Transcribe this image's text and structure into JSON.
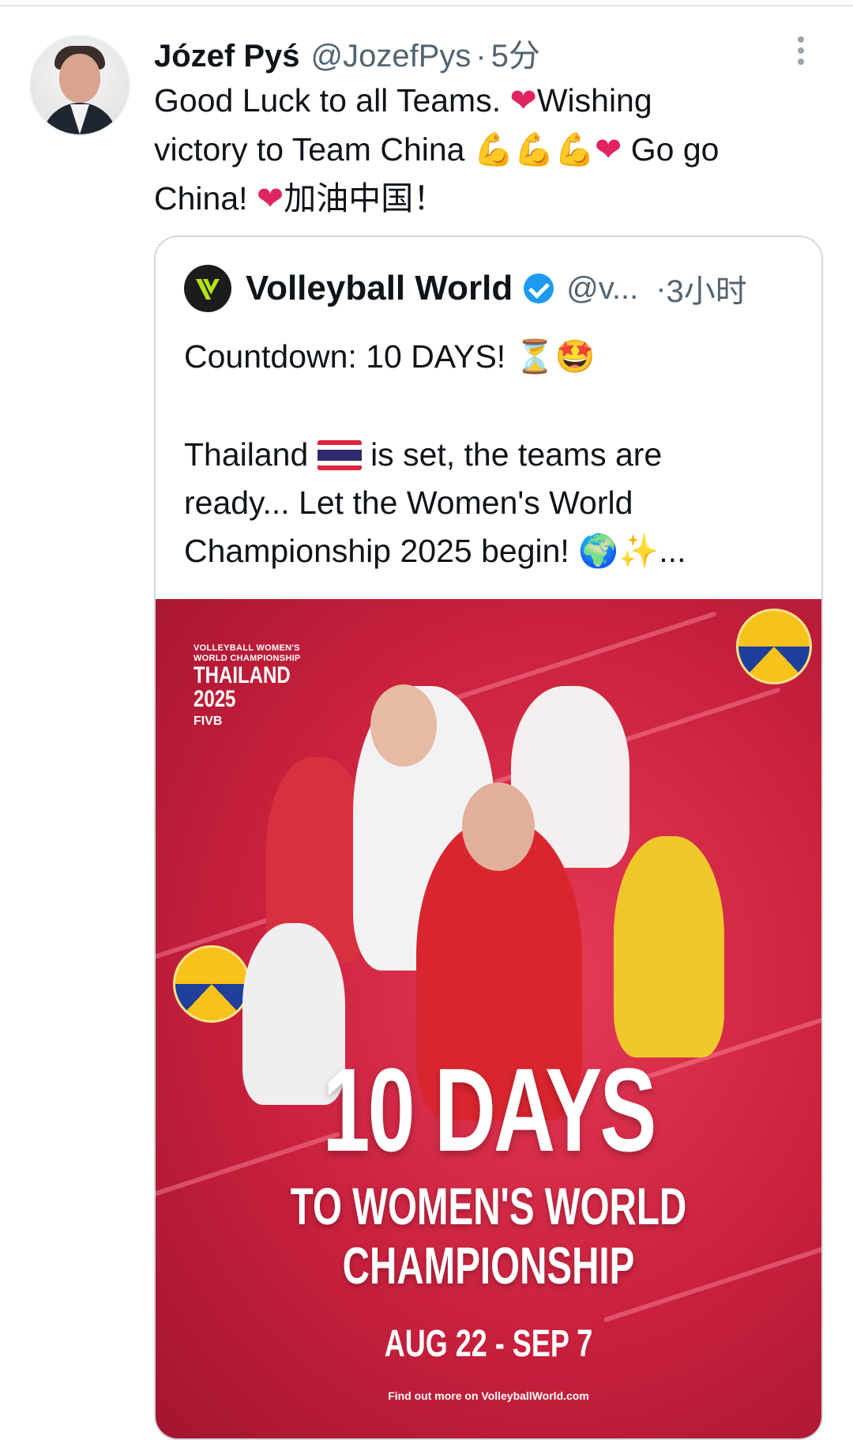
{
  "tweet": {
    "author_name": "Józef Pyś",
    "author_handle": "@JozefPys",
    "time": "5分",
    "text_line1_a": "Good Luck to all Teams. ",
    "text_line1_b": "Wishing",
    "text_line2_a": "victory to Team China ",
    "text_line2_b": " Go go",
    "text_line3_a": "China! ",
    "text_line3_b": "加油中国！",
    "heart_glyph": "❤",
    "muscle_glyphs": "💪💪💪"
  },
  "quote": {
    "author_name": "Volleyball World",
    "author_handle": "@v...",
    "time": "3小时",
    "line1": "Countdown: 10 DAYS! ⏳🤩",
    "line2_a": "Thailand ",
    "line2_b": " is set, the teams are",
    "line3": "ready... Let the Women's World",
    "line4": "Championship 2025 begin! 🌍✨..."
  },
  "poster": {
    "logo_sub1": "VOLLEYBALL WOMEN'S",
    "logo_sub2": "WORLD CHAMPIONSHIP",
    "logo_country": "THAILAND",
    "logo_year": "2025",
    "logo_fivb": "FIVB",
    "headline": "10 DAYS",
    "subhead1": "TO WOMEN'S WORLD",
    "subhead2": "CHAMPIONSHIP",
    "dates": "AUG 22 - SEP 7",
    "findout": "Find out more on VolleyballWorld.com"
  },
  "colors": {
    "verified": "#1d9bf0",
    "heart": "#e0245e",
    "poster_red": "#c8203d"
  }
}
